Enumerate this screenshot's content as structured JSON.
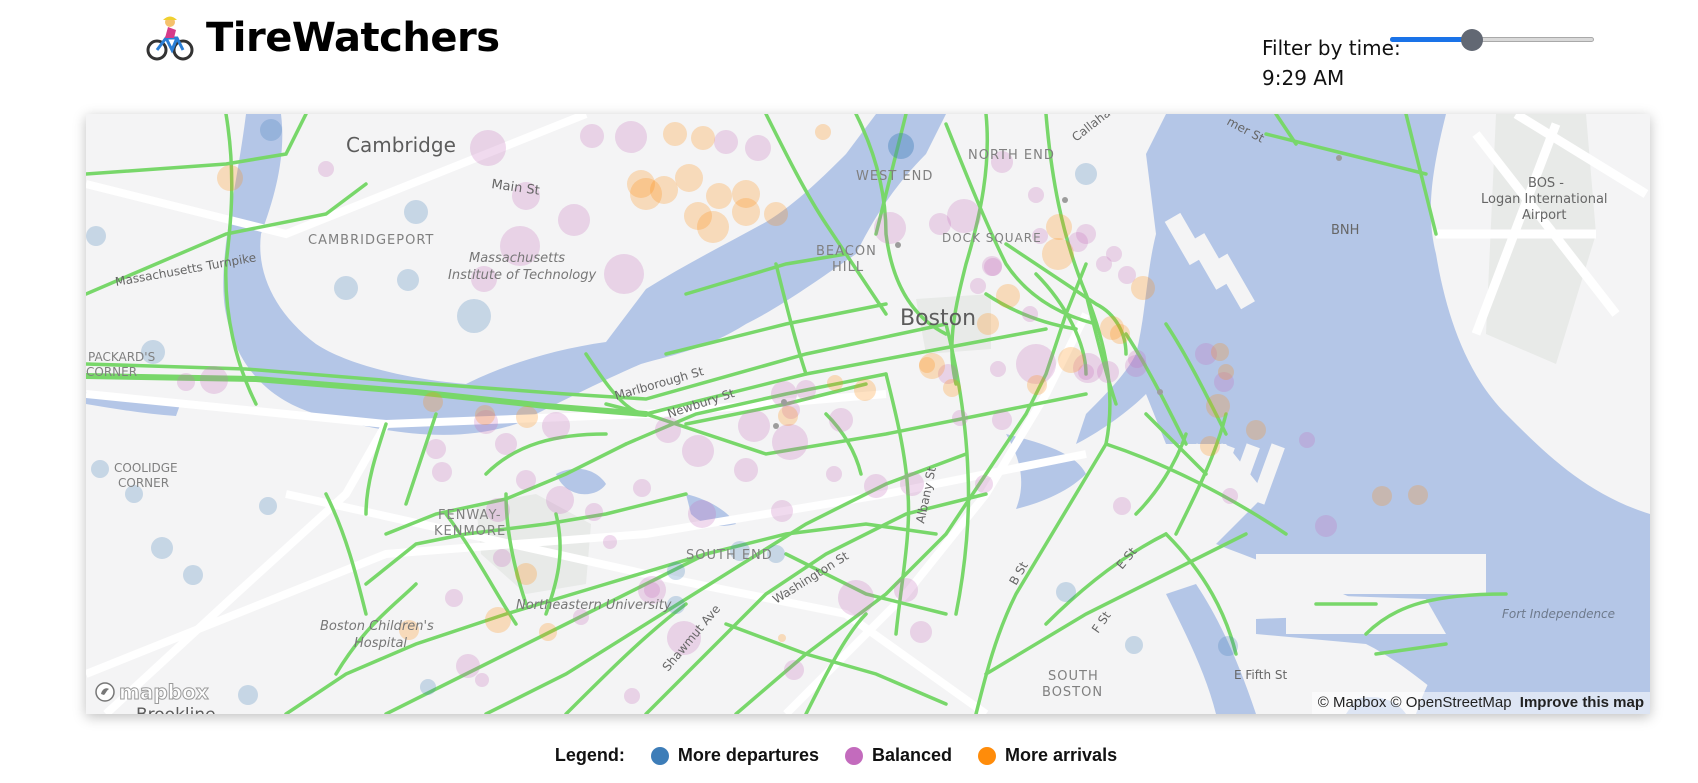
{
  "header": {
    "title": "TireWatchers",
    "logo_icon": "bicycle-rider-icon",
    "filter_label": "Filter by time:",
    "filter_value": "9:29 AM",
    "slider_fraction": 0.4
  },
  "map": {
    "labels": {
      "cambridge": "Cambridge",
      "cambridgeport": "CAMBRIDGEPORT",
      "mit_1": "Massachusetts",
      "mit_2": "Institute of Technology",
      "main_st": "Main St",
      "mass_pike": "Massachusetts Turnpike",
      "packards_1": "PACKARD'S",
      "packards_2": "CORNER",
      "coolidge_1": "COOLIDGE",
      "coolidge_2": "CORNER",
      "fenway_1": "FENWAY-",
      "fenway_2": "KENMORE",
      "childrens_1": "Boston Children's",
      "childrens_2": "Hospital",
      "brookline": "Brookline",
      "northeastern": "Northeastern University",
      "south_end": "SOUTH END",
      "shawmut": "Shawmut Ave",
      "washington": "Washington St",
      "albany": "Albany St",
      "marlborough": "Marlborough St",
      "newbury": "Newbury St",
      "beacon_hill_1": "BEACON",
      "beacon_hill_2": "HILL",
      "boston": "Boston",
      "west_end": "WEST END",
      "north_end": "NORTH END",
      "dock_square": "DOCK SQUARE",
      "callahan": "Callahan",
      "commercial": "mer St",
      "bos_1": "BOS -",
      "bos_2": "Logan International",
      "bos_3": "Airport",
      "bnh": "BNH",
      "b_st": "B St",
      "e_st": "E St",
      "f_st": "F St",
      "south_boston_1": "SOUTH",
      "south_boston_2": "BOSTON",
      "e_fifth": "E Fifth St",
      "fort_independence": "Fort Independence"
    },
    "mapbox_logo": "mapbox",
    "attribution": {
      "text": "© Mapbox © OpenStreetMap",
      "improve": "Improve this map"
    },
    "colors": {
      "water": "#b4c6e7",
      "land": "#f4f4f5",
      "park": "#e9ebe9",
      "bike_lane": "#78d76a",
      "departures": "#3d7db8",
      "balanced": "#c36bbd",
      "arrivals": "#ff8c0a"
    }
  },
  "legend": {
    "title": "Legend:",
    "items": [
      {
        "label": "More departures",
        "color": "#3d7db8"
      },
      {
        "label": "Balanced",
        "color": "#c36bbd"
      },
      {
        "label": "More arrivals",
        "color": "#ff8c0a"
      }
    ]
  }
}
